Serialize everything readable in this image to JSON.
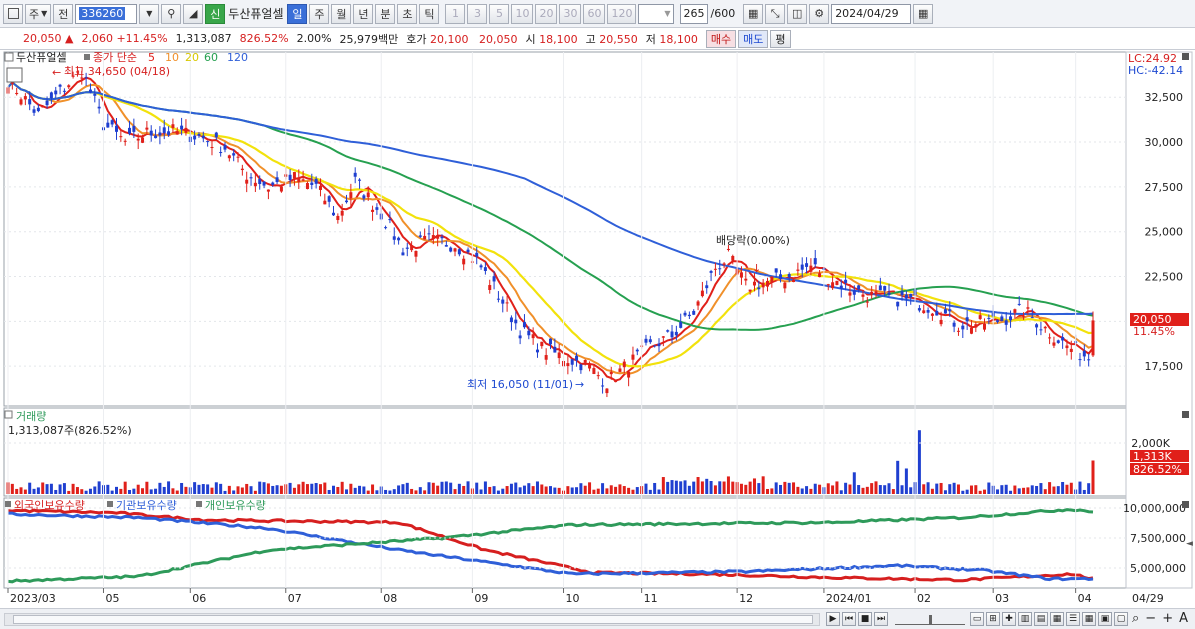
{
  "toolbar": {
    "period_label": "주",
    "prev_label": "전",
    "stock_code": "336260",
    "stock_name": "두산퓨얼셀",
    "shin_badge": "신",
    "periods": [
      "일",
      "주",
      "월",
      "년",
      "분",
      "초",
      "틱"
    ],
    "active_period": "일",
    "intervals": [
      "1",
      "3",
      "5",
      "10",
      "20",
      "30",
      "60",
      "120"
    ],
    "count_value": "265",
    "count_total": "/600",
    "date_value": "2024/04/29"
  },
  "info": {
    "price": "20,050",
    "change_arrow": "▲",
    "change": "2,060",
    "change_pct": "+11.45%",
    "volume": "1,313,087",
    "volume_ratio": "826.52%",
    "turnover": "2.00%",
    "amount": "25,979백만",
    "bid_label": "호가",
    "bid_price": "20,100",
    "ask_price": "20,050",
    "open_label": "시",
    "open": "18,100",
    "high_label": "고",
    "high": "20,550",
    "low_label": "저",
    "low": "18,100",
    "sell_button": "매수",
    "buy_button": "매도",
    "eval_button": "평"
  },
  "price_panel": {
    "legend_name": "두산퓨얼셀",
    "legend_type": "종가 단순",
    "ma_periods": [
      "5",
      "10",
      "20",
      "60",
      "120"
    ],
    "ma_colors": [
      "#e0201a",
      "#f0902a",
      "#f2e20c",
      "#26a050",
      "#2f5fd8"
    ],
    "lc_label": "LC:24.92",
    "hc_label": "HC:-42.14",
    "high_note": "최고 34,650 (04/18)",
    "low_note": "최저 16,050 (11/01)",
    "dividend_note": "배당락(0.00%)",
    "current_tag": "20,050",
    "current_pct": "11.45%"
  },
  "volume_panel": {
    "title": "거래량",
    "value": "1,313,087주(826.52%)",
    "tag": "1,313K",
    "tag_pct": "826.52%"
  },
  "holdings_panel": {
    "series_labels": [
      "외국인보유수량",
      "기관보유수량",
      "개인보유수량"
    ],
    "series_colors": [
      "#d61f1f",
      "#2f5fd8",
      "#2e9a5a"
    ]
  },
  "x_axis": {
    "labels": [
      "2023/03",
      "05",
      "06",
      "07",
      "08",
      "09",
      "10",
      "11",
      "12",
      "2024/01",
      "02",
      "03",
      "04"
    ],
    "last_label": "04/29"
  },
  "chart_data": [
    {
      "type": "candlestick",
      "title": "두산퓨얼셀 일봉",
      "y_ticks": [
        17500,
        20000,
        22500,
        25000,
        27500,
        30000,
        32500
      ],
      "ylim": [
        15500,
        34800
      ],
      "close_anchors": [
        [
          0,
          33500
        ],
        [
          7,
          31500
        ],
        [
          12,
          32800
        ],
        [
          17,
          34000
        ],
        [
          22,
          31000
        ],
        [
          27,
          30000
        ],
        [
          32,
          30500
        ],
        [
          38,
          30600
        ],
        [
          44,
          30300
        ],
        [
          50,
          29700
        ],
        [
          55,
          28200
        ],
        [
          60,
          27500
        ],
        [
          66,
          28000
        ],
        [
          71,
          27500
        ],
        [
          76,
          25800
        ],
        [
          80,
          27800
        ],
        [
          86,
          26000
        ],
        [
          91,
          24000
        ],
        [
          97,
          24500
        ],
        [
          103,
          24300
        ],
        [
          108,
          23400
        ],
        [
          113,
          21500
        ],
        [
          118,
          19500
        ],
        [
          123,
          18500
        ],
        [
          128,
          18000
        ],
        [
          133,
          17600
        ],
        [
          138,
          16600
        ],
        [
          143,
          17600
        ],
        [
          148,
          18600
        ],
        [
          153,
          19200
        ],
        [
          158,
          20500
        ],
        [
          163,
          23000
        ],
        [
          166,
          23600
        ],
        [
          170,
          22000
        ],
        [
          175,
          22200
        ],
        [
          180,
          22500
        ],
        [
          185,
          23100
        ],
        [
          189,
          22500
        ],
        [
          194,
          21800
        ],
        [
          199,
          21400
        ],
        [
          204,
          21300
        ],
        [
          209,
          21100
        ],
        [
          214,
          20700
        ],
        [
          219,
          19800
        ],
        [
          224,
          19900
        ],
        [
          229,
          20100
        ],
        [
          234,
          20600
        ],
        [
          239,
          19600
        ],
        [
          244,
          18600
        ],
        [
          249,
          18000
        ],
        [
          250,
          20050
        ]
      ],
      "ma5_last": 18900,
      "ma20_last": 19500,
      "ma60_last": 19900,
      "ma120_last": 20900,
      "last_close": 20050,
      "high": 34650,
      "low": 16050
    },
    {
      "type": "bar",
      "title": "거래량",
      "y_ticks": [
        2000000
      ],
      "ylim": [
        0,
        2900000
      ],
      "last_value": 1313087,
      "spikes": [
        [
          210,
          2500000
        ],
        [
          205,
          1300000
        ],
        [
          207,
          1000000
        ],
        [
          195,
          850000
        ],
        [
          250,
          1313087
        ]
      ]
    },
    {
      "type": "line",
      "y_ticks": [
        5000000,
        7500000,
        10000000
      ],
      "ylim": [
        3500000,
        10500000
      ],
      "series": [
        {
          "name": "외국인보유수량",
          "anchors": [
            [
              0,
              9800000
            ],
            [
              25,
              9600000
            ],
            [
              45,
              9000000
            ],
            [
              90,
              8800000
            ],
            [
              110,
              6500000
            ],
            [
              135,
              4600000
            ],
            [
              160,
              4500000
            ],
            [
              190,
              4200000
            ],
            [
              220,
              4000000
            ],
            [
              245,
              4500000
            ],
            [
              250,
              4100000
            ]
          ]
        },
        {
          "name": "기관보유수량",
          "anchors": [
            [
              0,
              9500000
            ],
            [
              30,
              9200000
            ],
            [
              60,
              8300000
            ],
            [
              90,
              6500000
            ],
            [
              130,
              4500000
            ],
            [
              170,
              4700000
            ],
            [
              205,
              5200000
            ],
            [
              225,
              4800000
            ],
            [
              240,
              4100000
            ],
            [
              250,
              4100000
            ]
          ]
        },
        {
          "name": "개인보유수량",
          "anchors": [
            [
              0,
              3900000
            ],
            [
              30,
              4300000
            ],
            [
              60,
              6500000
            ],
            [
              100,
              7500000
            ],
            [
              130,
              8600000
            ],
            [
              160,
              8700000
            ],
            [
              190,
              8800000
            ],
            [
              220,
              9200000
            ],
            [
              245,
              9900000
            ],
            [
              250,
              9700000
            ]
          ]
        }
      ]
    }
  ]
}
